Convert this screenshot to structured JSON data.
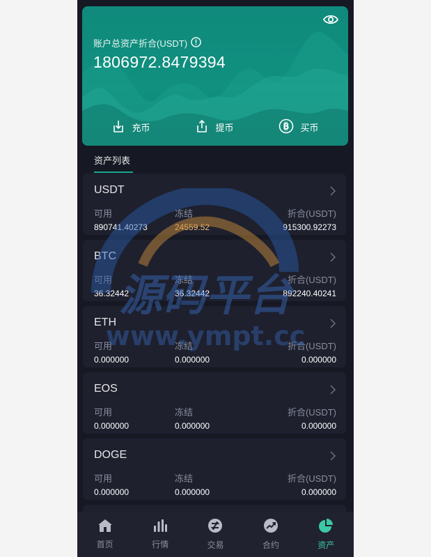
{
  "account": {
    "total_label": "账户总资产折合(USDT)",
    "total_value": "1806972.8479394"
  },
  "actions": [
    {
      "label": "充币",
      "icon": "deposit-icon"
    },
    {
      "label": "提币",
      "icon": "withdraw-icon"
    },
    {
      "label": "买币",
      "icon": "bitcoin-icon"
    }
  ],
  "section_title": "资产列表",
  "column_labels": {
    "available": "可用",
    "frozen": "冻结",
    "converted": "折合(USDT)"
  },
  "assets": [
    {
      "symbol": "USDT",
      "available": "890741.40273",
      "frozen": "24559.52",
      "converted": "915300.92273"
    },
    {
      "symbol": "BTC",
      "available": "36.32442",
      "frozen": "36.32442",
      "converted": "892240.40241"
    },
    {
      "symbol": "ETH",
      "available": "0.000000",
      "frozen": "0.000000",
      "converted": "0.000000"
    },
    {
      "symbol": "EOS",
      "available": "0.000000",
      "frozen": "0.000000",
      "converted": "0.000000"
    },
    {
      "symbol": "DOGE",
      "available": "0.000000",
      "frozen": "0.000000",
      "converted": "0.000000"
    }
  ],
  "watermark": {
    "title": "源码平台",
    "url": "www.ympt.cc"
  },
  "nav": [
    {
      "label": "首页",
      "icon": "home-icon"
    },
    {
      "label": "行情",
      "icon": "market-chart-icon"
    },
    {
      "label": "交易",
      "icon": "trade-icon"
    },
    {
      "label": "合约",
      "icon": "contract-icon"
    },
    {
      "label": "资产",
      "icon": "assets-pie-icon",
      "active": true
    }
  ],
  "colors": {
    "accent": "#3cc8a5",
    "hero": "#11907f",
    "background": "#161823",
    "card": "#1e202e"
  }
}
